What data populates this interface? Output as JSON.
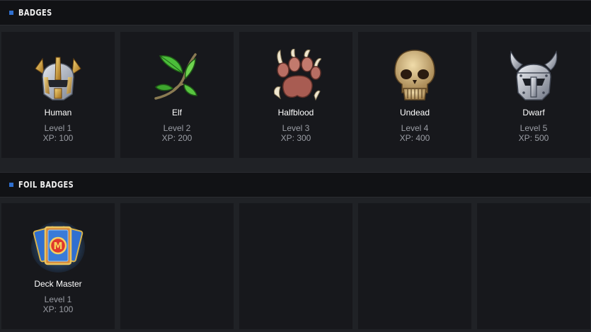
{
  "badges": {
    "title": "BADGES",
    "items": [
      {
        "name": "Human",
        "level": "Level 1",
        "xp": "XP: 100",
        "icon": "helmet-icon"
      },
      {
        "name": "Elf",
        "level": "Level 2",
        "xp": "XP: 200",
        "icon": "leaf-branch-icon"
      },
      {
        "name": "Halfblood",
        "level": "Level 3",
        "xp": "XP: 300",
        "icon": "claw-paw-icon"
      },
      {
        "name": "Undead",
        "level": "Level 4",
        "xp": "XP: 400",
        "icon": "skull-icon"
      },
      {
        "name": "Dwarf",
        "level": "Level 5",
        "xp": "XP: 500",
        "icon": "horned-helmet-icon"
      }
    ]
  },
  "foil_badges": {
    "title": "FOIL BADGES",
    "items": [
      {
        "name": "Deck Master",
        "level": "Level 1",
        "xp": "XP: 100",
        "icon": "card-deck-icon"
      }
    ]
  },
  "colors": {
    "accent": "#2f6fcf",
    "card_bg": "#17181c",
    "page_bg": "#202226",
    "header_bg": "#111215",
    "muted_text": "#9a9da4"
  }
}
